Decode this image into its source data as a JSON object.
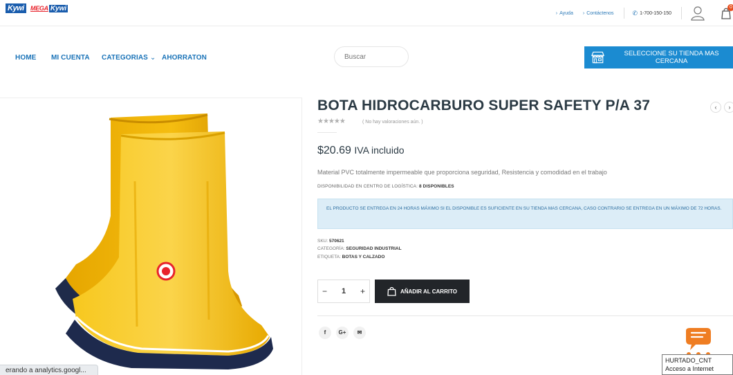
{
  "topbar": {
    "logo_text": "Kywi",
    "logo2_text_mega": "MEGA",
    "logo2_text_kywi": "Kywi",
    "links": [
      {
        "label": "Ayuda"
      },
      {
        "label": "Contáctenos"
      }
    ],
    "phone": "1-700-150-150",
    "cart_count": "0"
  },
  "nav": {
    "items": [
      {
        "label": "HOME"
      },
      {
        "label": "MI CUENTA"
      },
      {
        "label": "CATEGORIAS"
      },
      {
        "label": "AHORRATON"
      }
    ],
    "search_placeholder": "Buscar",
    "store_button_label": "SELECCIONE SU TIENDA MAS CERCANA"
  },
  "product": {
    "title": "BOTA HIDROCARBURO SUPER SAFETY P/A 37",
    "rating_stars": "★★★★★",
    "rating_text": "( No hay valoraciones aún. )",
    "price": "$20.69",
    "price_suffix": "IVA incluido",
    "description": "Material PVC totalmente impermeable que proporciona seguridad, Resistencia y comodidad en el trabajo",
    "availability_label": "DISPONIBILIDAD EN CENTRO DE LOGÍSTICA:",
    "availability_value": "8 DISPONIBLES",
    "notice": "EL PRODUCTO SE ENTREGA EN 24 HORAS MÁXIMO SI EL DISPONIBLE ES SUFICIENTE EN SU TIENDA MAS CERCANA, CASO CONTRARIO SE ENTREGA EN UN MÁXIMO DE 72 HORAS.",
    "sku_label": "SKU:",
    "sku_value": "570621",
    "category_label": "CATEGORÍA:",
    "category_value": "SEGURIDAD INDUSTRIAL",
    "tag_label": "ETIQUETA:",
    "tag_value": "BOTAS Y CALZADO",
    "quantity": "1",
    "minus": "−",
    "plus": "+",
    "add_to_cart_label": "AÑADIR AL CARRITO",
    "prev": "‹",
    "next": "›"
  },
  "social": [
    {
      "label": "f"
    },
    {
      "label": "G+"
    },
    {
      "label": "✉"
    }
  ],
  "status_bar": "erando a analytics.googl...",
  "tooltip": {
    "line1": "HURTADO_CNT",
    "line2": "Acceso a Internet"
  },
  "colors": {
    "accent_blue": "#1b8bd1",
    "nav_blue": "#1a73b8",
    "dark_button": "#222529",
    "boot_yellow": "#f5b800",
    "chat_orange": "#ef7d22"
  }
}
